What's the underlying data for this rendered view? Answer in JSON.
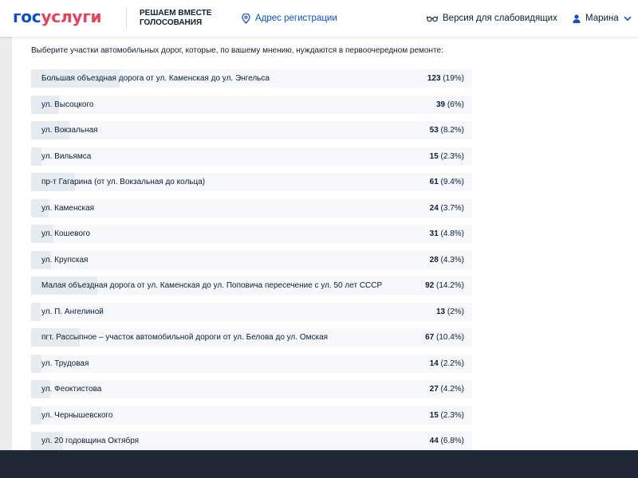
{
  "header": {
    "logo_part1": "гос",
    "logo_part2": "услуги",
    "tagline_line1": "РЕШАЕМ ВМЕСТЕ",
    "tagline_line2": "ГОЛОСОВАНИЯ",
    "address_label": "Адрес регистрации",
    "vision_label": "Версия для слабовидящих",
    "user_name": "Марина",
    "colors": {
      "brand_blue": "#0d4cd3",
      "brand_red": "#ee3f58"
    }
  },
  "question": {
    "prompt": "Выберите участки автомобильных дорог, которые, по вашему мнению, нуждаются в первоочередном ремонте:"
  },
  "results": [
    {
      "label": "Большая объездная дорога от ул. Каменская до ул. Энгельса",
      "count": "123",
      "percent": "(19%)",
      "share": 19
    },
    {
      "label": "ул. Высоцкого",
      "count": "39",
      "percent": "(6%)",
      "share": 6
    },
    {
      "label": "ул. Вокзальная",
      "count": "53",
      "percent": "(8.2%)",
      "share": 8.2
    },
    {
      "label": "ул. Вильямса",
      "count": "15",
      "percent": "(2.3%)",
      "share": 2.3
    },
    {
      "label": "пр-т Гагарина (от ул. Вокзальная до кольца)",
      "count": "61",
      "percent": "(9.4%)",
      "share": 9.4
    },
    {
      "label": "ул. Каменская",
      "count": "24",
      "percent": "(3.7%)",
      "share": 3.7
    },
    {
      "label": "ул. Кошевого",
      "count": "31",
      "percent": "(4.8%)",
      "share": 4.8
    },
    {
      "label": "ул. Крупская",
      "count": "28",
      "percent": "(4.3%)",
      "share": 4.3
    },
    {
      "label": "Малая объездная дорога от ул. Каменская до ул. Поповича пересечение с ул. 50 лет СССР",
      "count": "92",
      "percent": "(14.2%)",
      "share": 14.2
    },
    {
      "label": "ул. П. Ангелиной",
      "count": "13",
      "percent": "(2%)",
      "share": 2
    },
    {
      "label": "пгт. Рассыпное – участок автомобильной дороги от ул. Белова до ул. Омская",
      "count": "67",
      "percent": "(10.4%)",
      "share": 10.4
    },
    {
      "label": "ул. Трудовая",
      "count": "14",
      "percent": "(2.2%)",
      "share": 2.2
    },
    {
      "label": "ул. Феоктистова",
      "count": "27",
      "percent": "(4.2%)",
      "share": 4.2
    },
    {
      "label": "ул. Чернышевского",
      "count": "15",
      "percent": "(2.3%)",
      "share": 2.3
    },
    {
      "label": "ул. 20 годовщина Октября",
      "count": "44",
      "percent": "(6.8%)",
      "share": 6.8
    }
  ],
  "icons": {
    "address": "location-pin-icon",
    "vision": "glasses-icon",
    "user": "user-icon",
    "user_menu": "chevron-down-icon"
  }
}
